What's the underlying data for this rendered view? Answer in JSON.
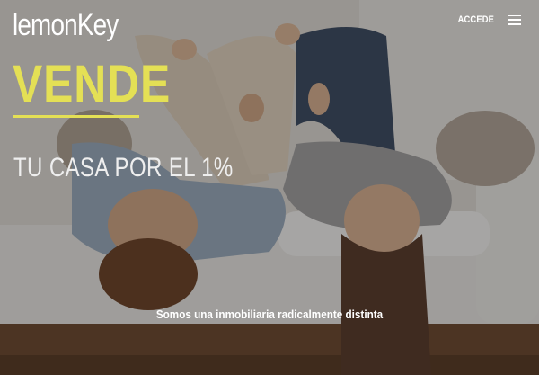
{
  "brand": {
    "logo_text": "lemonKey"
  },
  "nav": {
    "login_label": "ACCEDE",
    "menu_icon": "hamburger-menu-icon"
  },
  "hero": {
    "headline": "VENDE",
    "subheadline": "TU CASA POR EL 1%",
    "tagline": "Somos una inmobiliaria radicalmente distinta",
    "accent_color": "#e4e055"
  }
}
